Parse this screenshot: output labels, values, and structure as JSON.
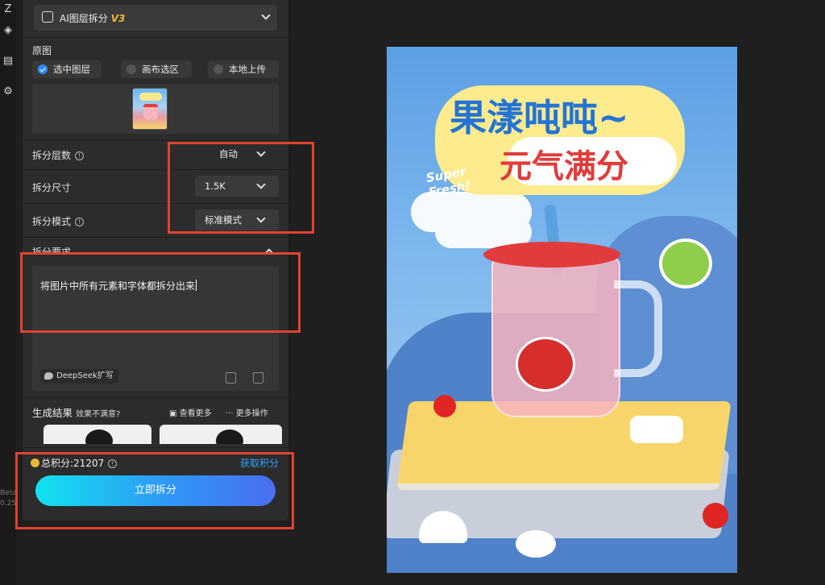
{
  "panel": {
    "header_title": "AI图层拆分",
    "header_version": "V3"
  },
  "source": {
    "label": "原图",
    "options": [
      "选中图层",
      "画布选区",
      "本地上传"
    ],
    "selected_index": 0
  },
  "settings": {
    "layers_label": "拆分层数",
    "layers_value": "自动",
    "size_label": "拆分尺寸",
    "size_value": "1.5K",
    "mode_label": "拆分模式",
    "mode_value": "标准模式",
    "requirement_label": "拆分要求"
  },
  "requirement": {
    "text": "将图片中所有元素和字体都拆分出来",
    "deepseek_label": "DeepSeek扩写"
  },
  "results": {
    "label": "生成结果",
    "feedback": "效果不满意?",
    "view_more": "查看更多",
    "more_actions": "··· 更多操作"
  },
  "footer": {
    "points_label": "总积分:21207",
    "get_points": "获取积分",
    "split_button": "立即拆分"
  },
  "version": {
    "line1": "Beta",
    "line2": "0.25"
  },
  "artwork": {
    "title_line1": "果漾吨吨~",
    "title_line2": "元气满分",
    "tagline": "Super Fresh!"
  },
  "colors": {
    "accent_blue": "#2f97f6",
    "annotation_red": "#e0432f",
    "version_gold": "#f2b635"
  }
}
